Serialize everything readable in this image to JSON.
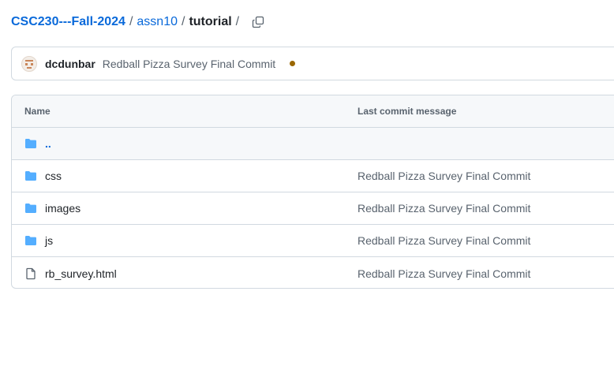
{
  "breadcrumb": {
    "repo": "CSC230---Fall-2024",
    "folder": "assn10",
    "current": "tutorial",
    "separator": "/"
  },
  "commit_bar": {
    "author": "dcdunbar",
    "message": "Redball Pizza Survey Final Commit",
    "status_color": "#9a6700"
  },
  "table": {
    "headers": {
      "name": "Name",
      "last_commit_message": "Last commit message"
    },
    "parent_row": {
      "label": ".."
    },
    "rows": [
      {
        "type": "folder",
        "name": "css",
        "message": "Redball Pizza Survey Final Commit"
      },
      {
        "type": "folder",
        "name": "images",
        "message": "Redball Pizza Survey Final Commit"
      },
      {
        "type": "folder",
        "name": "js",
        "message": "Redball Pizza Survey Final Commit"
      },
      {
        "type": "file",
        "name": "rb_survey.html",
        "message": "Redball Pizza Survey Final Commit"
      }
    ]
  },
  "colors": {
    "link": "#0969da",
    "folder_icon": "#54aeff",
    "muted_text": "#59636e",
    "border": "#d1d9e0"
  },
  "icons": {
    "copy": "copy-icon",
    "folder": "folder-icon",
    "file": "file-icon"
  }
}
